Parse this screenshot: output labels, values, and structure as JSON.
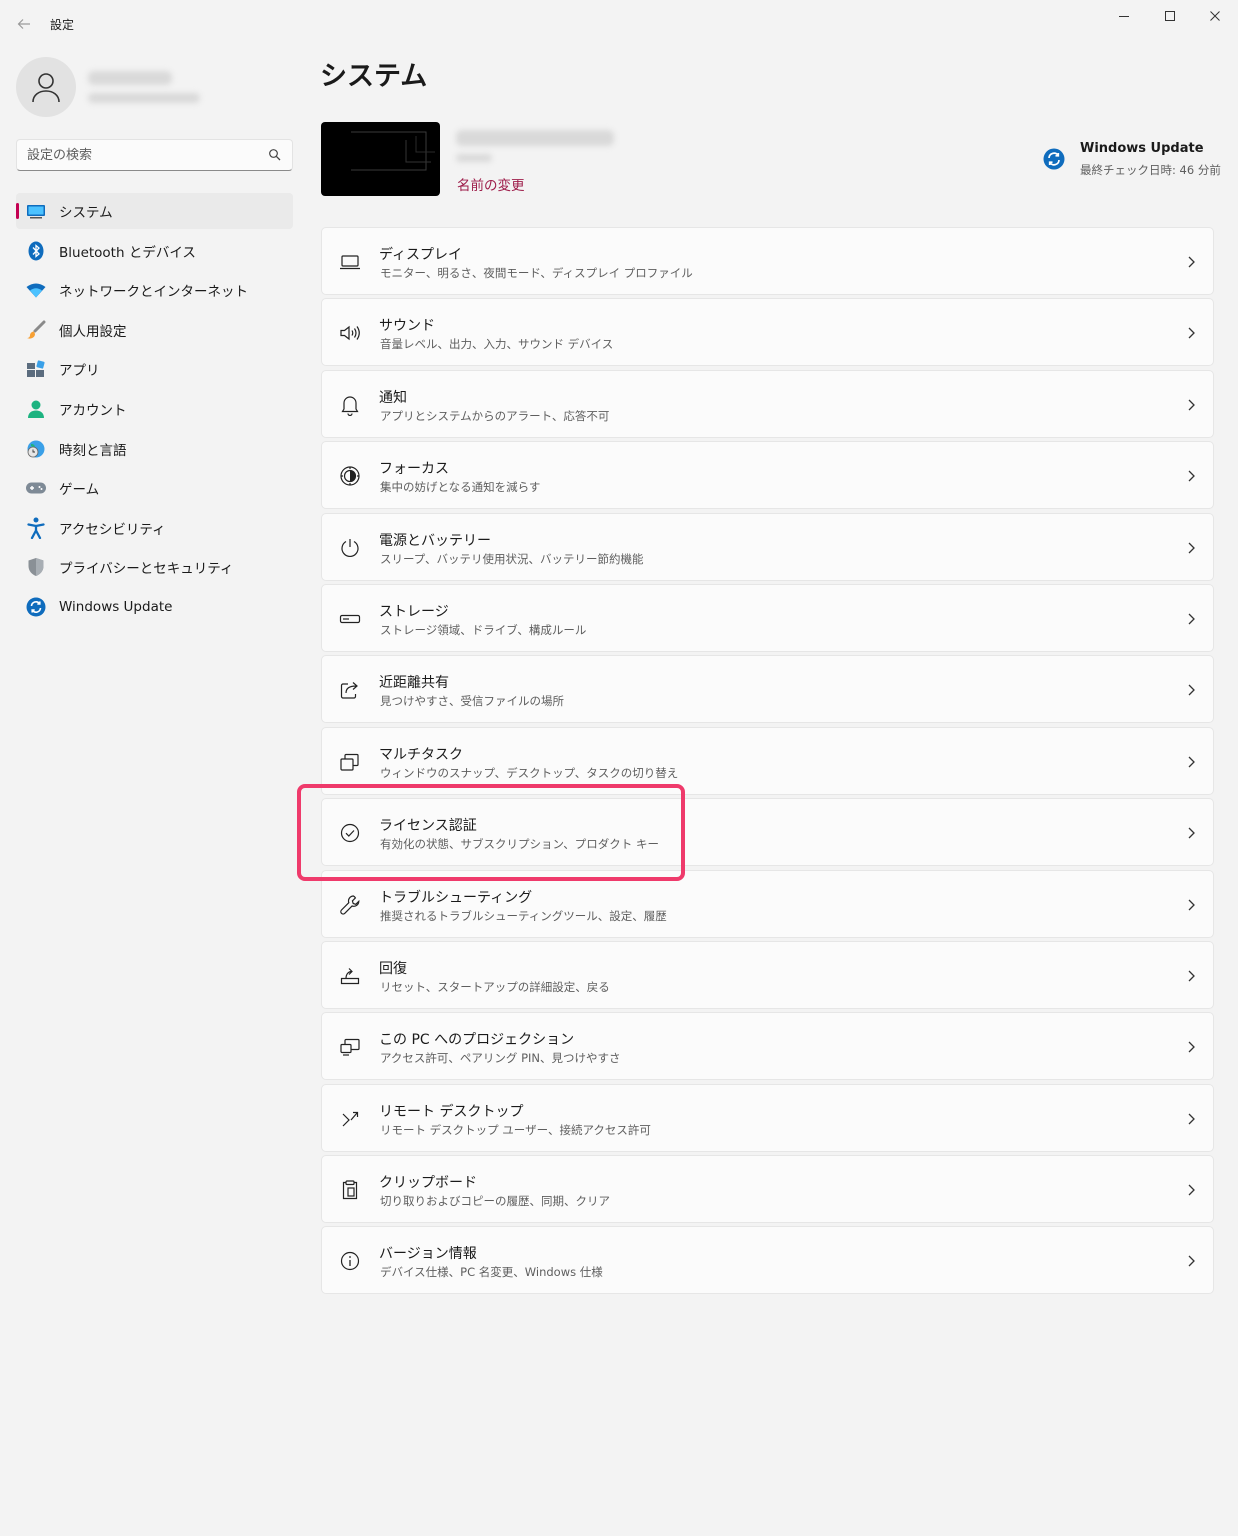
{
  "window": {
    "title": "設定"
  },
  "sidebar": {
    "search_placeholder": "設定の検索",
    "items": [
      {
        "label": "システム",
        "icon": "system-icon",
        "selected": true
      },
      {
        "label": "Bluetooth とデバイス",
        "icon": "bluetooth-icon"
      },
      {
        "label": "ネットワークとインターネット",
        "icon": "network-icon"
      },
      {
        "label": "個人用設定",
        "icon": "personalization-brush-icon"
      },
      {
        "label": "アプリ",
        "icon": "apps-icon"
      },
      {
        "label": "アカウント",
        "icon": "account-icon"
      },
      {
        "label": "時刻と言語",
        "icon": "time-language-icon"
      },
      {
        "label": "ゲーム",
        "icon": "gamepad-icon"
      },
      {
        "label": "アクセシビリティ",
        "icon": "accessibility-icon"
      },
      {
        "label": "プライバシーとセキュリティ",
        "icon": "shield-icon"
      },
      {
        "label": "Windows Update",
        "icon": "windows-update-icon"
      }
    ]
  },
  "main": {
    "title": "システム",
    "rename_link": "名前の変更",
    "windows_update": {
      "title": "Windows Update",
      "subtitle": "最終チェック日時: 46 分前"
    },
    "cards": [
      {
        "title": "ディスプレイ",
        "subtitle": "モニター、明るさ、夜間モード、ディスプレイ プロファイル",
        "icon": "display-icon"
      },
      {
        "title": "サウンド",
        "subtitle": "音量レベル、出力、入力、サウンド デバイス",
        "icon": "speaker-icon"
      },
      {
        "title": "通知",
        "subtitle": "アプリとシステムからのアラート、応答不可",
        "icon": "bell-icon"
      },
      {
        "title": "フォーカス",
        "subtitle": "集中の妨げとなる通知を減らす",
        "icon": "focus-icon"
      },
      {
        "title": "電源とバッテリー",
        "subtitle": "スリープ、バッテリ使用状況、バッテリー節約機能",
        "icon": "power-icon"
      },
      {
        "title": "ストレージ",
        "subtitle": "ストレージ領域、ドライブ、構成ルール",
        "icon": "storage-icon"
      },
      {
        "title": "近距離共有",
        "subtitle": "見つけやすさ、受信ファイルの場所",
        "icon": "share-icon"
      },
      {
        "title": "マルチタスク",
        "subtitle": "ウィンドウのスナップ、デスクトップ、タスクの切り替え",
        "icon": "multitask-icon"
      },
      {
        "title": "ライセンス認証",
        "subtitle": "有効化の状態、サブスクリプション、プロダクト キー",
        "icon": "check-circle-icon"
      },
      {
        "title": "トラブルシューティング",
        "subtitle": "推奨されるトラブルシューティングツール、設定、履歴",
        "icon": "wrench-icon"
      },
      {
        "title": "回復",
        "subtitle": "リセット、スタートアップの詳細設定、戻る",
        "icon": "recovery-icon"
      },
      {
        "title": "この PC へのプロジェクション",
        "subtitle": "アクセス許可、ペアリング PIN、見つけやすさ",
        "icon": "projection-icon"
      },
      {
        "title": "リモート デスクトップ",
        "subtitle": "リモート デスクトップ ユーザー、接続アクセス許可",
        "icon": "remote-desktop-icon"
      },
      {
        "title": "クリップボード",
        "subtitle": "切り取りおよびコピーの履歴、同期、クリア",
        "icon": "clipboard-icon"
      },
      {
        "title": "バージョン情報",
        "subtitle": "デバイス仕様、PC 名変更、Windows 仕様",
        "icon": "info-icon"
      }
    ]
  },
  "colors": {
    "accent": "#c30052",
    "link": "#9e1d4a",
    "highlight": "#ef3a6b",
    "windows_blue": "#0f6cbd"
  }
}
